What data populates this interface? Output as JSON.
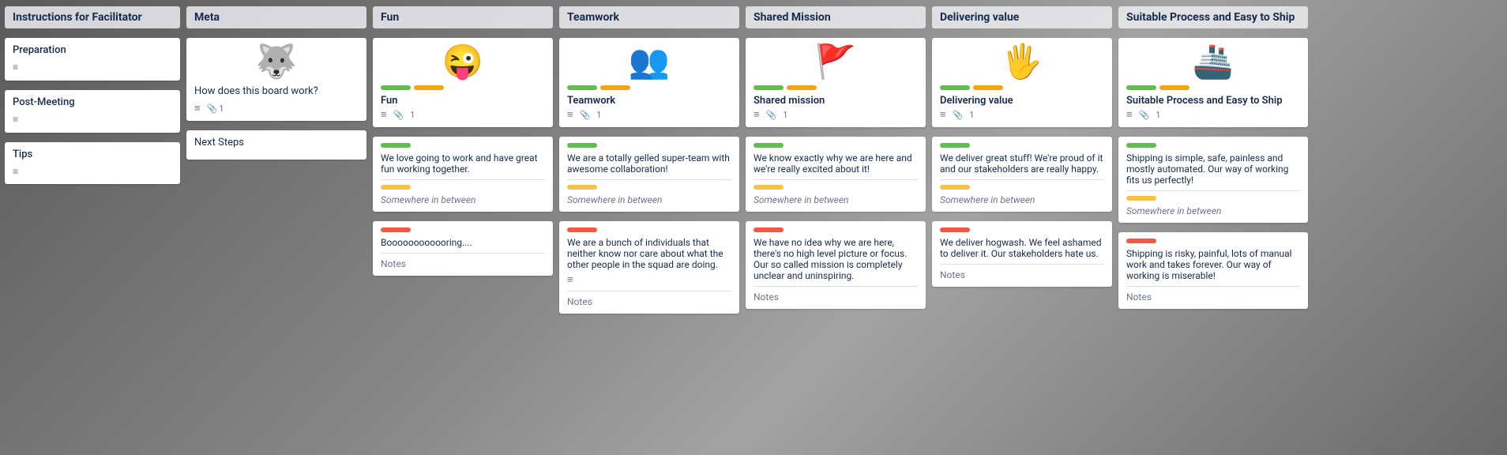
{
  "columns": [
    {
      "id": "instructions",
      "header": "Instructions for Facilitator",
      "cards": [
        {
          "title": "Preparation",
          "hasLines": true
        },
        {
          "title": "Post-Meeting",
          "hasLines": true
        },
        {
          "title": "Tips",
          "hasLines": true
        }
      ]
    },
    {
      "id": "meta",
      "header": "Meta",
      "cards": [
        {
          "emoji": "🐺",
          "text": "How does this board work?",
          "hasLines": true,
          "attachCount": "1"
        },
        {
          "title": "Next Steps",
          "isSimple": true
        }
      ]
    },
    {
      "id": "fun",
      "header": "Fun",
      "mainCard": {
        "emoji": "😜",
        "labelGreen": true,
        "labelOrange": true,
        "title": "Fun",
        "hasLines": true,
        "attachCount": "1"
      },
      "subCards": [
        {
          "labelGreen": true,
          "body": "We love going to work and have great fun working together.",
          "bottomLabel": "Somewhere in between"
        },
        {
          "labelRed": true,
          "body": "Boooooooooooring....",
          "notes": "Notes"
        }
      ]
    },
    {
      "id": "teamwork",
      "header": "Teamwork",
      "mainCard": {
        "emoji": "👥",
        "labelGreen": true,
        "labelOrange": true,
        "title": "Teamwork",
        "hasLines": true,
        "attachCount": "1"
      },
      "subCards": [
        {
          "labelGreen": true,
          "body": "We are a totally gelled super-team with awesome collaboration!",
          "bottomLabel": "Somewhere in between"
        },
        {
          "labelRed": true,
          "body": "We are a bunch of individuals that neither know nor care about what the other people in the squad are doing.",
          "hasLines": true,
          "notes": "Notes"
        }
      ]
    },
    {
      "id": "shared-mission",
      "header": "Shared Mission",
      "mainCard": {
        "emoji": "🚩",
        "labelGreen": true,
        "labelOrange": true,
        "title": "Shared mission",
        "hasLines": true,
        "attachCount": "1"
      },
      "subCards": [
        {
          "labelGreen": true,
          "body": "We know exactly why we are here and we're really excited about it!",
          "bottomLabel": "Somewhere in between"
        },
        {
          "labelRed": true,
          "body": "We have no idea why we are here, there's no high level picture or focus. Our so called mission is completely unclear and uninspiring.",
          "notes": "Notes"
        }
      ]
    },
    {
      "id": "delivering-value",
      "header": "Delivering value",
      "mainCard": {
        "emoji": "🖐️",
        "labelGreen": true,
        "labelOrange": true,
        "title": "Delivering value",
        "hasLines": true,
        "attachCount": "1"
      },
      "subCards": [
        {
          "labelGreen": true,
          "body": "We deliver great stuff! We're proud of it and our stakeholders are really happy.",
          "bottomLabel": "Somewhere in between"
        },
        {
          "labelRed": true,
          "body": "We deliver hogwash. We feel ashamed to deliver it. Our stakeholders hate us.",
          "notes": "Notes"
        }
      ]
    },
    {
      "id": "suitable-process",
      "header": "Suitable Process and Easy to Ship",
      "mainCard": {
        "emoji": "🚢",
        "labelGreen": true,
        "labelOrange": true,
        "title": "Suitable Process and Easy to Ship",
        "hasLines": true,
        "attachCount": "1"
      },
      "subCards": [
        {
          "labelGreen": true,
          "body": "Shipping is simple, safe, painless and mostly automated. Our way of working fits us perfectly!",
          "bottomLabel": "Somewhere in between"
        },
        {
          "labelRed": true,
          "body": "Shipping is risky, painful, lots of manual work and takes forever. Our way of working is miserable!",
          "notes": "Notes"
        }
      ]
    }
  ],
  "icons": {
    "lines": "≡",
    "attach": "📎"
  }
}
